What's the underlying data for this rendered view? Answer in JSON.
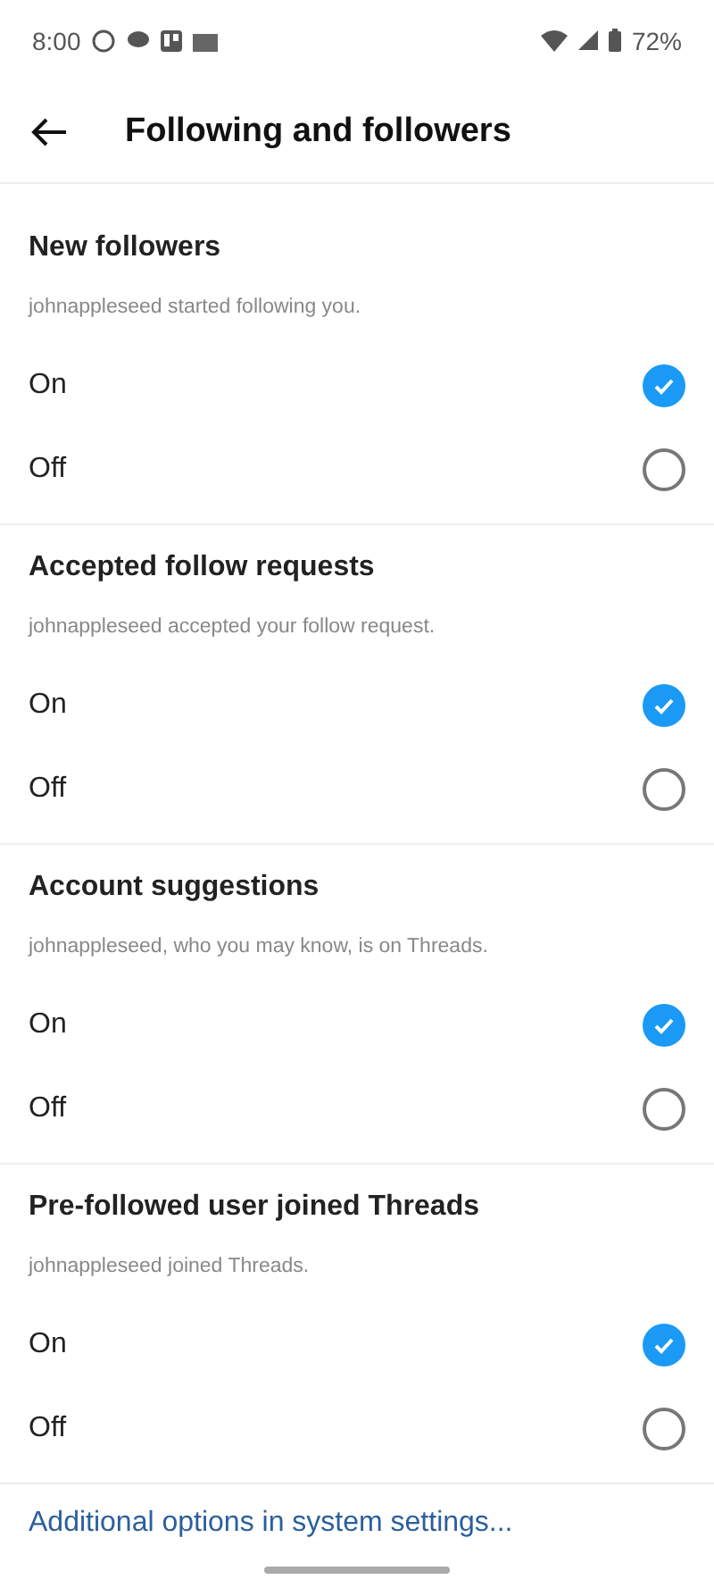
{
  "status_bar": {
    "time": "8:00",
    "battery": "72%"
  },
  "header": {
    "title": "Following and followers"
  },
  "sections": [
    {
      "title": "New followers",
      "description": "johnappleseed started following you.",
      "options": [
        {
          "label": "On",
          "selected": true
        },
        {
          "label": "Off",
          "selected": false
        }
      ]
    },
    {
      "title": "Accepted follow requests",
      "description": "johnappleseed accepted your follow request.",
      "options": [
        {
          "label": "On",
          "selected": true
        },
        {
          "label": "Off",
          "selected": false
        }
      ]
    },
    {
      "title": "Account suggestions",
      "description": "johnappleseed, who you may know, is on Threads.",
      "options": [
        {
          "label": "On",
          "selected": true
        },
        {
          "label": "Off",
          "selected": false
        }
      ]
    },
    {
      "title": "Pre-followed user joined Threads",
      "description": "johnappleseed joined Threads.",
      "options": [
        {
          "label": "On",
          "selected": true
        },
        {
          "label": "Off",
          "selected": false
        }
      ]
    }
  ],
  "footer_link": "Additional options in system settings..."
}
